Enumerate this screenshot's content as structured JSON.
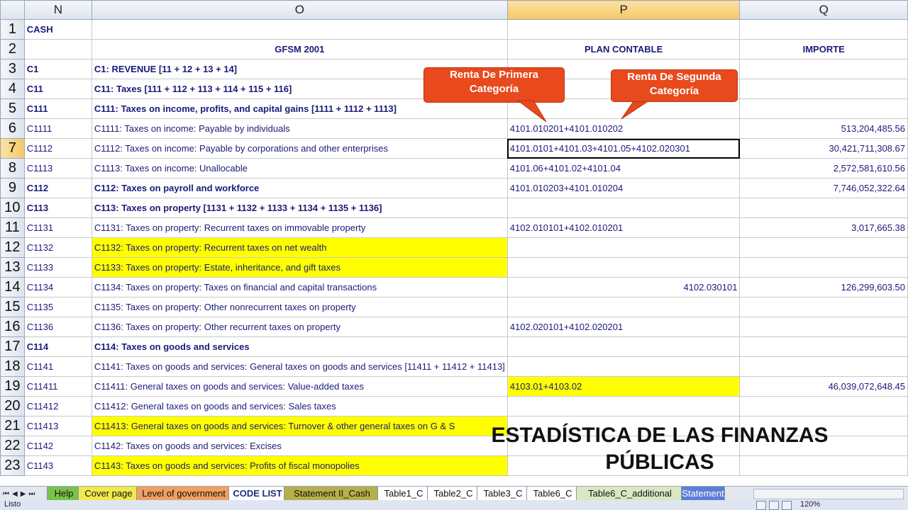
{
  "columns": [
    "N",
    "O",
    "P",
    "Q"
  ],
  "rows": [
    {
      "num": "1",
      "code": "CASH",
      "desc": "",
      "plan": "",
      "importe": "",
      "style": "cash"
    },
    {
      "num": "2",
      "code": "",
      "desc": "GFSM 2001",
      "plan": "PLAN CONTABLE",
      "importe": "IMPORTE",
      "style": "header"
    },
    {
      "num": "3",
      "code": "C1",
      "desc": "C1:  REVENUE [11 + 12 + 13 + 14]",
      "plan": "",
      "importe": "",
      "style": "bold"
    },
    {
      "num": "4",
      "code": "C11",
      "desc": "C11:  Taxes  [111 + 112 + 113 + 114 + 115 + 116]",
      "plan": "",
      "importe": "",
      "style": "bold"
    },
    {
      "num": "5",
      "code": "C111",
      "desc": "C111:  Taxes on income, profits, and capital gains [1111 + 1112 + 1113]",
      "plan": "",
      "importe": "",
      "style": "bold"
    },
    {
      "num": "6",
      "code": "C1111",
      "desc": "C1111:  Taxes on income: Payable by individuals",
      "plan": "4101.010201+4101.010202",
      "importe": "513,204,485.56",
      "style": "normal"
    },
    {
      "num": "7",
      "code": "C1112",
      "desc": "C1112:  Taxes on income: Payable by corporations and other enterprises",
      "plan": "4101.0101+4101.03+4101.05+4102.020301",
      "importe": "30,421,711,308.67",
      "style": "normal"
    },
    {
      "num": "8",
      "code": "C1113",
      "desc": "C1113:  Taxes on income: Unallocable",
      "plan": "4101.06+4101.02+4101.04",
      "importe": "2,572,581,610.56",
      "style": "normal"
    },
    {
      "num": "9",
      "code": "C112",
      "desc": "C112:  Taxes on payroll and workforce",
      "plan": "4101.010203+4101.010204",
      "importe": "7,746,052,322.64",
      "style": "bold"
    },
    {
      "num": "10",
      "code": "C113",
      "desc": "C113:  Taxes on property [1131 + 1132 + 1133 + 1134 + 1135 + 1136]",
      "plan": "",
      "importe": "",
      "style": "bold"
    },
    {
      "num": "11",
      "code": "C1131",
      "desc": "C1131:  Taxes on property:  Recurrent taxes on immovable property",
      "plan": "4102.010101+4102.010201",
      "importe": "3,017,665.38",
      "style": "normal"
    },
    {
      "num": "12",
      "code": "C1132",
      "desc": "C1132:  Taxes on property:  Recurrent taxes on net wealth",
      "plan": "",
      "importe": "",
      "style": "yellow"
    },
    {
      "num": "13",
      "code": "C1133",
      "desc": "C1133:  Taxes on property:  Estate, inheritance, and gift taxes",
      "plan": "",
      "importe": "",
      "style": "yellow"
    },
    {
      "num": "14",
      "code": "C1134",
      "desc": "C1134:  Taxes on property:  Taxes on financial and capital transactions",
      "plan": "4102.030101",
      "importe": "126,299,603.50",
      "style": "right-plan"
    },
    {
      "num": "15",
      "code": "C1135",
      "desc": "C1135:  Taxes on property:  Other nonrecurrent taxes on property",
      "plan": "",
      "importe": "",
      "style": "normal"
    },
    {
      "num": "16",
      "code": "C1136",
      "desc": "C1136:  Taxes on property:  Other recurrent taxes on property",
      "plan": "4102.020101+4102.020201",
      "importe": "",
      "style": "normal"
    },
    {
      "num": "17",
      "code": "C114",
      "desc": "C114:  Taxes on goods and services",
      "plan": "",
      "importe": "",
      "style": "bold"
    },
    {
      "num": "18",
      "code": "C1141",
      "desc": "C1141:  Taxes on goods and services:  General taxes on goods and services  [11411 + 11412 + 11413]",
      "plan": "",
      "importe": "",
      "style": "normal"
    },
    {
      "num": "19",
      "code": "C11411",
      "desc": "C11411:  General taxes on goods and services:  Value-added taxes",
      "plan": "4103.01+4103.02",
      "importe": "46,039,072,648.45",
      "style": "yellow-plan"
    },
    {
      "num": "20",
      "code": "C11412",
      "desc": "C11412:  General taxes on goods and services:  Sales taxes",
      "plan": "",
      "importe": "",
      "style": "normal"
    },
    {
      "num": "21",
      "code": "C11413",
      "desc": "C11413:  General taxes on goods and services:  Turnover & other general taxes on G & S",
      "plan": "",
      "importe": "",
      "style": "yellow"
    },
    {
      "num": "22",
      "code": "C1142",
      "desc": "C1142:  Taxes on goods and services:  Excises",
      "plan": "",
      "importe": "",
      "style": "normal"
    },
    {
      "num": "23",
      "code": "C1143",
      "desc": "C1143:  Taxes on goods and services:  Profits of fiscal monopolies",
      "plan": "",
      "importe": "",
      "style": "yellow"
    }
  ],
  "callouts": {
    "primera": "Renta De Primera Categoría",
    "segunda": "Renta De Segunda Categoría"
  },
  "overlay_title": "ESTADÍSTICA DE LAS FINANZAS PÚBLICAS",
  "tabs": [
    {
      "label": "Help",
      "color": "#79c24a"
    },
    {
      "label": "Cover page",
      "color": "#f2e94e"
    },
    {
      "label": "Level of government",
      "color": "#f0a060"
    },
    {
      "label": "CODE LIST",
      "color": "#ffffff"
    },
    {
      "label": "Statement II_Cash",
      "color": "#b6b04a"
    },
    {
      "label": "Table1_C",
      "color": "#ffffff"
    },
    {
      "label": "Table2_C",
      "color": "#ffffff"
    },
    {
      "label": "Table3_C",
      "color": "#ffffff"
    },
    {
      "label": "Table6_C",
      "color": "#ffffff"
    },
    {
      "label": "Table6_C_additional",
      "color": "#d9e8c2"
    },
    {
      "label": "Statement",
      "color": "#5b7fd6"
    }
  ],
  "status": {
    "text": "Listo",
    "zoom": "120%"
  }
}
